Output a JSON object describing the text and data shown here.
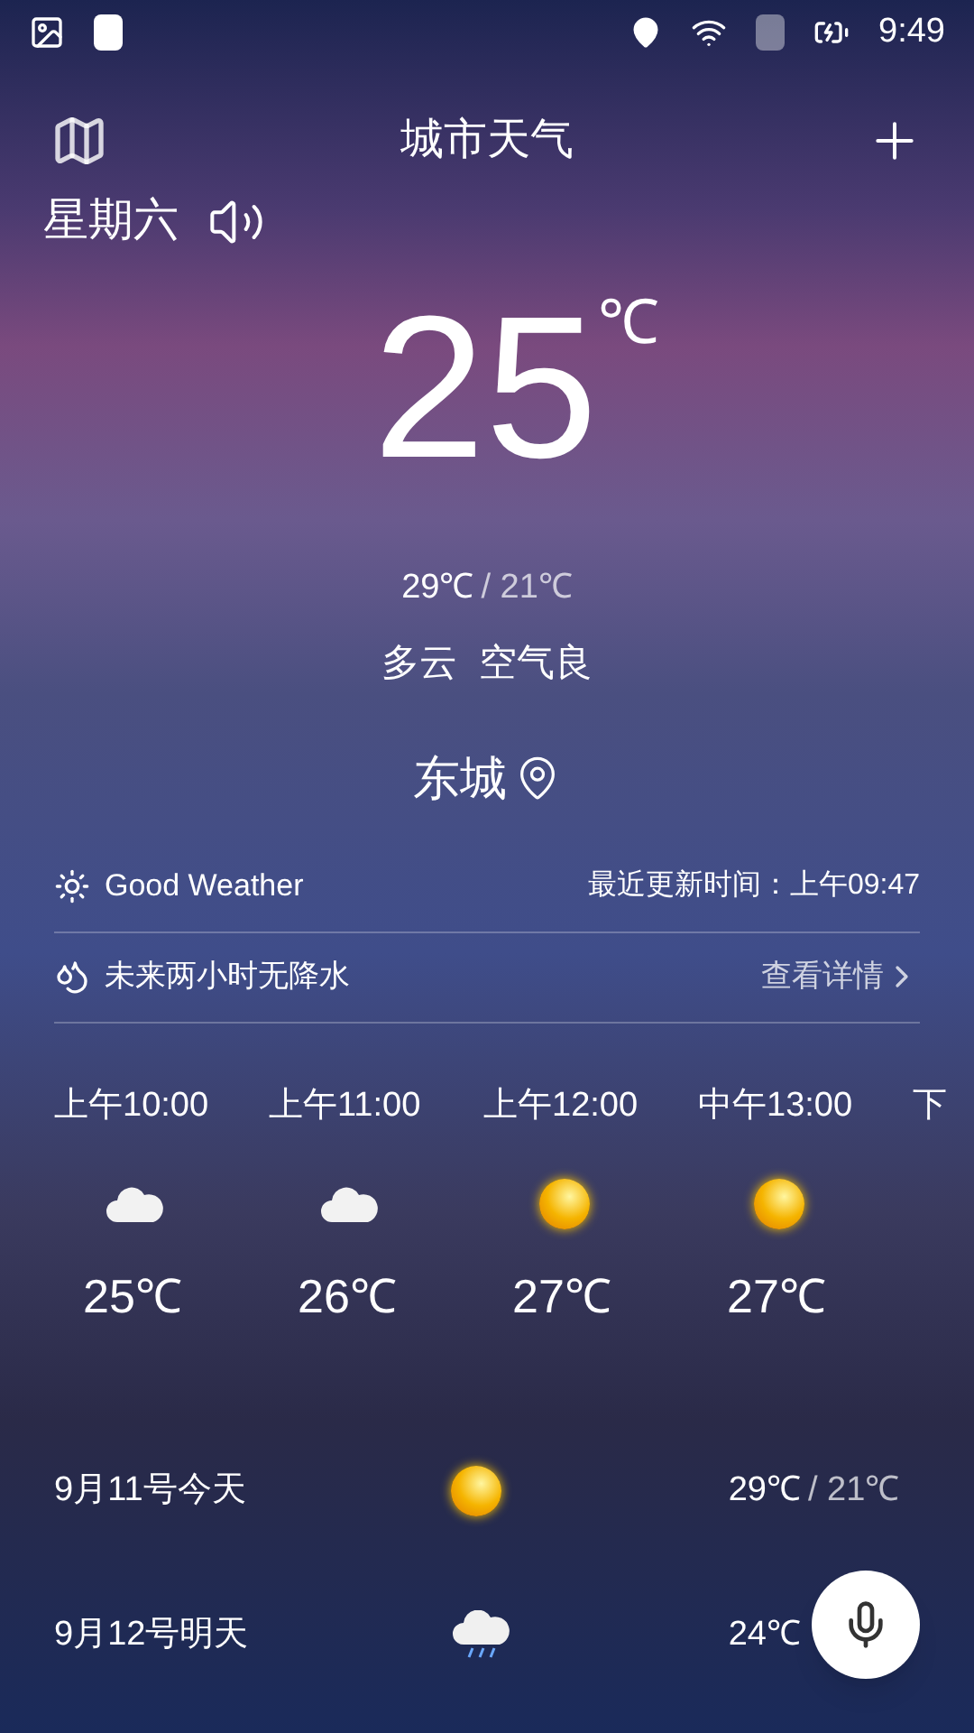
{
  "status_bar": {
    "time": "9:49"
  },
  "header": {
    "title": "城市天气"
  },
  "day": "星期六",
  "current": {
    "temp": "25",
    "unit": "℃",
    "high": "29℃",
    "low": "/ 21℃",
    "condition": "多云",
    "air": "空气良",
    "city": "东城"
  },
  "info_rows": [
    {
      "kind": "weather",
      "text": "Good Weather",
      "right": "最近更新时间：上午09:47"
    },
    {
      "kind": "rain",
      "text": "未来两小时无降水",
      "right": "查看详情"
    }
  ],
  "hourly": [
    {
      "time": "上午10:00",
      "kind": "cloudy",
      "temp": "25℃"
    },
    {
      "time": "上午11:00",
      "kind": "cloudy",
      "temp": "26℃"
    },
    {
      "time": "上午12:00",
      "kind": "sunny",
      "temp": "27℃"
    },
    {
      "time": "中午13:00",
      "kind": "sunny",
      "temp": "27℃"
    },
    {
      "time": "下"
    }
  ],
  "daily": [
    {
      "date": "9月11号今天",
      "kind": "sunny",
      "high": "29℃",
      "low": "/ 21℃"
    },
    {
      "date": "9月12号明天",
      "kind": "rain",
      "high": "24℃"
    }
  ]
}
